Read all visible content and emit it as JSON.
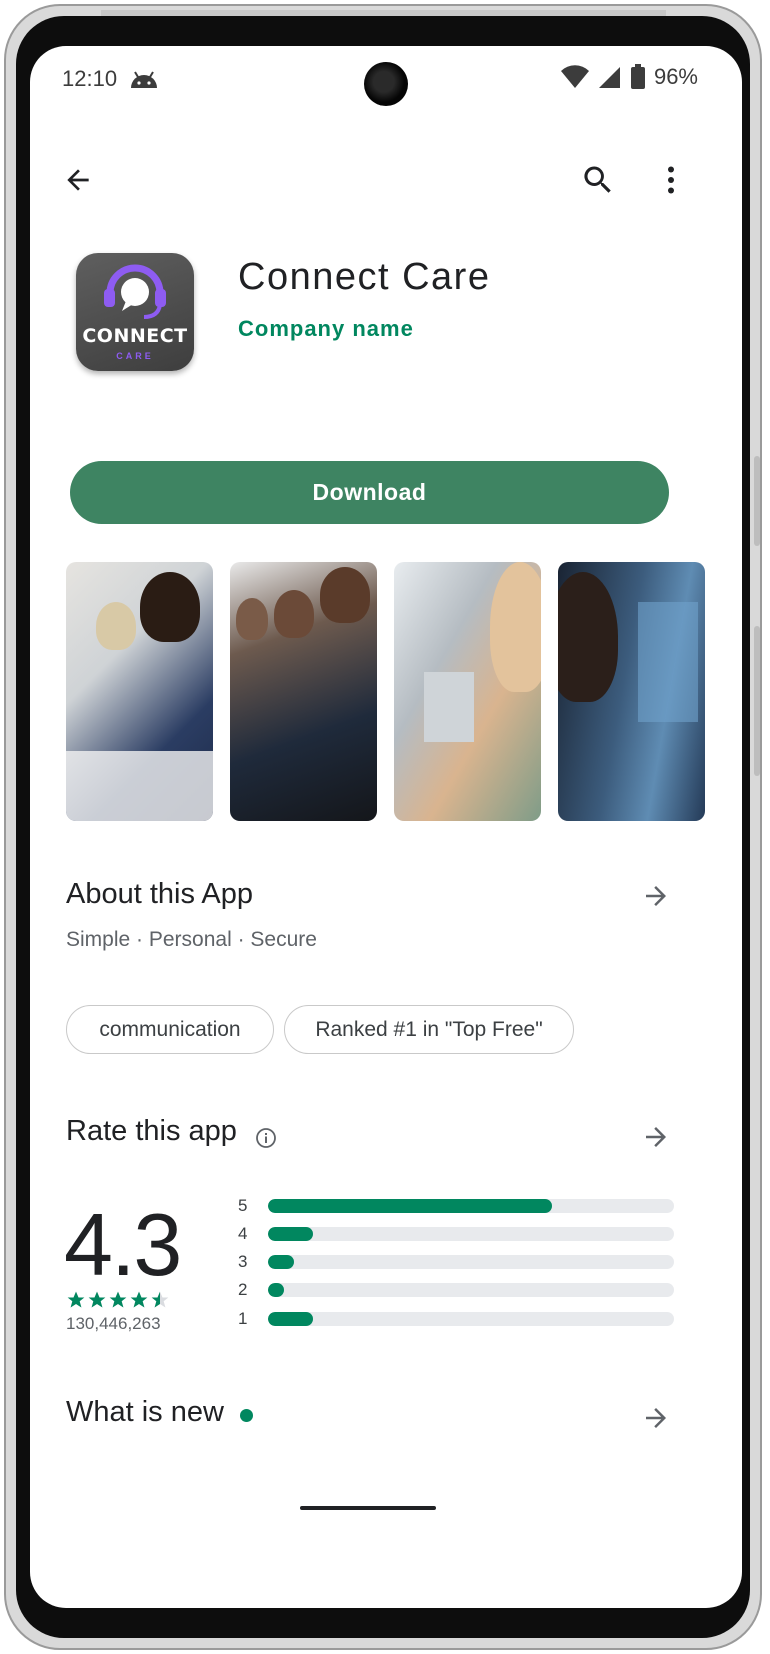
{
  "status_bar": {
    "time": "12:10",
    "battery": "96%"
  },
  "icons": {
    "back": "arrow-left-icon",
    "search": "search-icon",
    "more": "more-vert-icon",
    "info": "info-icon",
    "arrow": "arrow-right-icon"
  },
  "app": {
    "logo_text": "CONNECT",
    "logo_subtext": "CARE",
    "title": "Connect Care",
    "company": "Company name"
  },
  "download_label": "Download",
  "screenshots": [
    "Agents at desks with headsets",
    "Team of smiling agents",
    "Agent with headset at office",
    "Agent in front of monitors"
  ],
  "about": {
    "title": "About this App",
    "subtitle": "Simple · Personal · Secure"
  },
  "chips": [
    "communication",
    "Ranked #1 in \"Top Free\""
  ],
  "rate": {
    "title": "Rate this app",
    "average": "4.3",
    "stars": 4.5,
    "review_count": "130,446,263",
    "distribution": [
      {
        "label": "5",
        "fraction": 0.7
      },
      {
        "label": "4",
        "fraction": 0.11
      },
      {
        "label": "3",
        "fraction": 0.065
      },
      {
        "label": "2",
        "fraction": 0.04
      },
      {
        "label": "1",
        "fraction": 0.11
      }
    ]
  },
  "whats_new": {
    "title": "What is new"
  },
  "colors": {
    "accent_green": "#01875f",
    "download_green": "#3e8462",
    "logo_purple": "#8e5cf2"
  }
}
